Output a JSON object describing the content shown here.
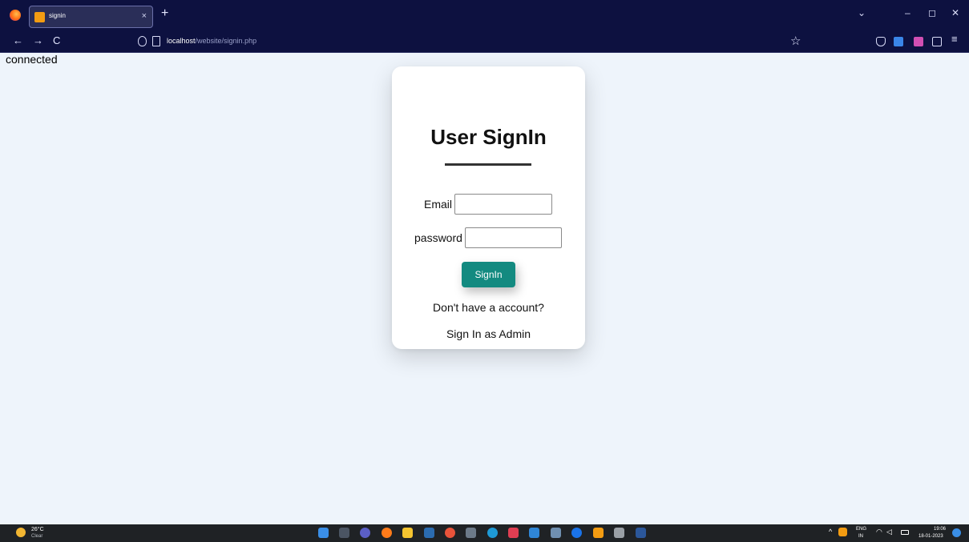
{
  "browser": {
    "tab_title": "signin",
    "tab_close": "×",
    "new_tab": "+",
    "url_host": "localhost",
    "url_path": "/website/signin.php",
    "back": "←",
    "forward": "→",
    "reload": "C",
    "bookmark_star": "☆",
    "dropdown": "⌄",
    "minimize": "–",
    "restore": "◻",
    "close": "✕",
    "menu": "≡"
  },
  "page": {
    "status": "connected"
  },
  "form": {
    "title": "User SignIn",
    "email_label": "Email",
    "email_value": "",
    "password_label": "password",
    "password_value": "",
    "submit_label": "SignIn",
    "register_link": "Don't have a account?",
    "admin_link": "Sign In as Admin"
  },
  "taskbar": {
    "temperature": "26°C",
    "condition": "Clear",
    "language": "ENG",
    "region": "IN",
    "time": "19:06",
    "date": "18-01-2023"
  },
  "colors": {
    "accent_button": "#138a80",
    "browser_chrome": "#0d1140",
    "page_background": "#eef4fb"
  }
}
